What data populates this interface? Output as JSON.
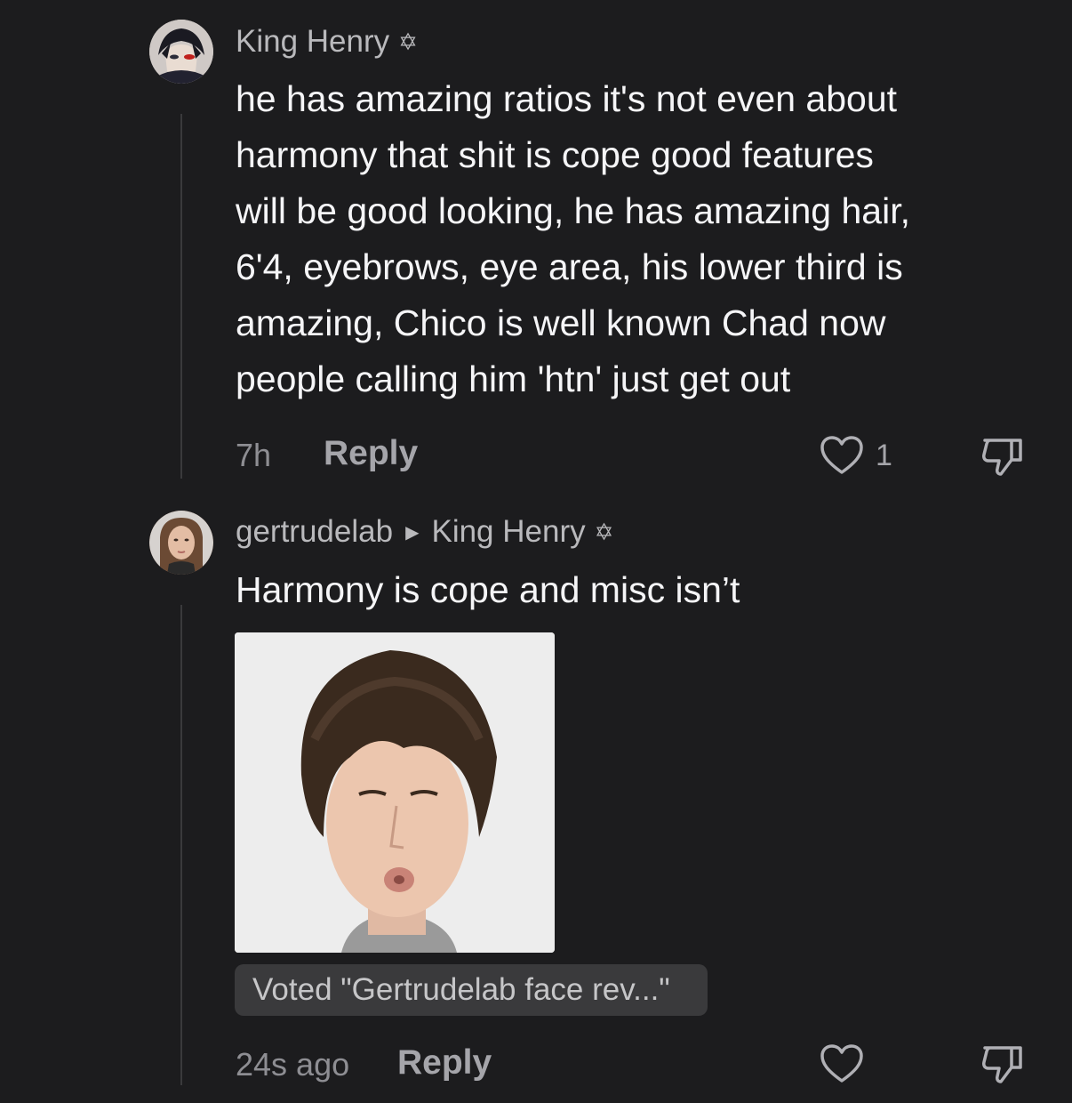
{
  "comments": [
    {
      "username": "King Henry",
      "badge_icon": "star-of-david-icon",
      "text": "he has amazing ratios it's not even about\nharmony that shit is cope good features\nwill be good looking, he has amazing hair,\n6'4, eyebrows, eye area, his lower third is\namazing, Chico is well known Chad now\npeople calling him 'htn' just get out",
      "time": "7h",
      "reply_label": "Reply",
      "like_count": "1"
    },
    {
      "username": "gertrudelab",
      "reply_to": "King Henry",
      "reply_to_badge_icon": "star-of-david-icon",
      "text": "Harmony is cope and misc isn’t",
      "vote_label": "Voted \"Gertrudelab face rev...\"",
      "time": "24s ago",
      "reply_label": "Reply",
      "like_count": ""
    }
  ],
  "icons": {
    "star": "✡",
    "arrow": "▶"
  },
  "colors": {
    "background": "#1c1c1e",
    "text": "#f5f5f7",
    "muted": "#8e8e93",
    "pill": "#3a3a3c"
  }
}
